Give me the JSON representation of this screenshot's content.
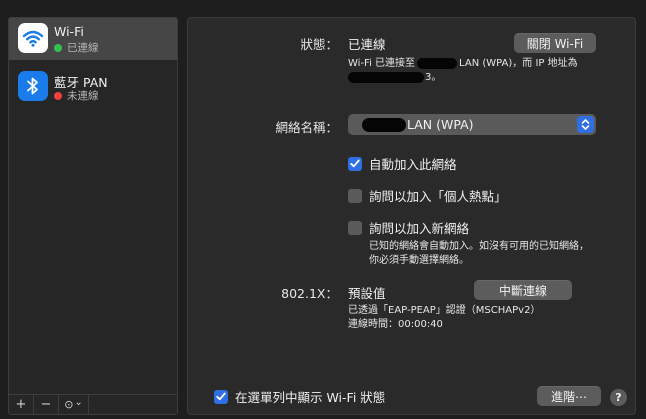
{
  "sidebar": {
    "items": [
      {
        "name": "Wi-Fi",
        "status": "已連線",
        "status_color": "#32c24d",
        "icon": "wifi-icon",
        "selected": true
      },
      {
        "name": "藍牙 PAN",
        "status": "未連線",
        "status_color": "#f0413c",
        "icon": "bluetooth-icon",
        "selected": false
      }
    ],
    "toolbar": {
      "add": "+",
      "remove": "−",
      "action": "⊙",
      "action_chevron": "⌄"
    }
  },
  "detail": {
    "status_label": "狀態：",
    "status_value": "已連線",
    "turn_off_button": "關閉 Wi-Fi",
    "status_desc_line1_prefix": "Wi-Fi 已連接至",
    "status_desc_line1_suffix": "LAN (WPA)，而 IP 地址為",
    "status_desc_line2_suffix": "3。",
    "network_label": "網絡名稱：",
    "network_value_suffix": "LAN (WPA)",
    "options": [
      {
        "label": "自動加入此網絡",
        "checked": true
      },
      {
        "label": "詢問以加入「個人熱點」",
        "checked": false
      },
      {
        "label": "詢問以加入新網絡",
        "checked": false
      }
    ],
    "note_line1": "已知的網絡會自動加入。如沒有可用的已知網絡，",
    "note_line2": "你必須手動選擇網絡。",
    "dot1x_label": "802.1X：",
    "dot1x_value": "預設值",
    "disconnect_button": "中斷連線",
    "dot1x_desc_line1": "已透過「EAP-PEAP」認證（MSCHAPv2）",
    "dot1x_desc_line2": "連線時間：00:00:40",
    "show_in_menubar": {
      "label": "在選單列中顯示 Wi-Fi 狀態",
      "checked": true
    },
    "advanced_button": "進階⋯",
    "help_button": "?"
  },
  "colors": {
    "accent": "#2f6fe3",
    "connected": "#32c24d",
    "disconnected": "#f0413c"
  }
}
